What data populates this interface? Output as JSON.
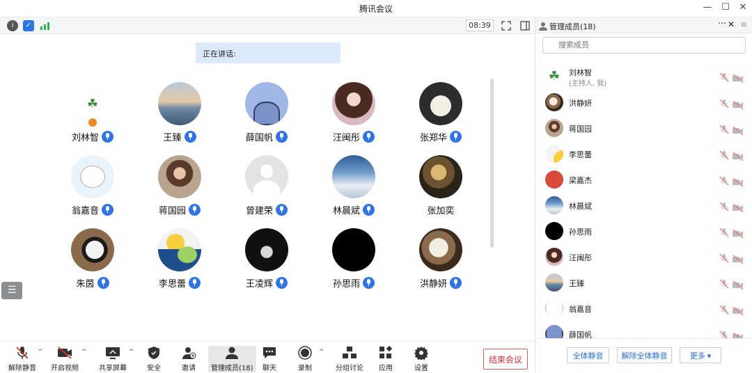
{
  "window": {
    "title": "腾讯会议"
  },
  "meeting": {
    "timer": "08:39",
    "speaking_label": "正在讲话:"
  },
  "participants": [
    {
      "name": "刘林智",
      "avatar": "clover-avatar",
      "mic": true
    },
    {
      "name": "王臻",
      "avatar": "beach-avatar",
      "mic": true
    },
    {
      "name": "薛国帆",
      "avatar": "cartoon-avatar",
      "mic": true
    },
    {
      "name": "汪闽彤",
      "avatar": "girl-avatar",
      "mic": true
    },
    {
      "name": "张郑华",
      "avatar": "dog-avatar",
      "mic": true
    },
    {
      "name": "翁嘉音",
      "avatar": "bear-avatar",
      "mic": true
    },
    {
      "name": "蒋国园",
      "avatar": "selfie-avatar",
      "mic": true
    },
    {
      "name": "曾建荣",
      "avatar": "default-avatar",
      "mic": true
    },
    {
      "name": "林晨斌",
      "avatar": "sky-avatar",
      "mic": true
    },
    {
      "name": "张加奕",
      "avatar": "painting-avatar",
      "mic": false
    },
    {
      "name": "朱茵",
      "avatar": "panda-avatar",
      "mic": true
    },
    {
      "name": "李思蕾",
      "avatar": "duck-avatar",
      "mic": true
    },
    {
      "name": "王凌辉",
      "avatar": "night-avatar",
      "mic": true
    },
    {
      "name": "孙思雨",
      "avatar": "black-avatar",
      "mic": true
    },
    {
      "name": "洪静妍",
      "avatar": "cat-avatar",
      "mic": true
    }
  ],
  "toolbar": {
    "unmute": "解除静音",
    "video": "开启视频",
    "share": "共享屏幕",
    "security": "安全",
    "invite": "邀请",
    "members": "管理成员(18)",
    "chat": "聊天",
    "record": "录制",
    "breakout": "分组讨论",
    "apps": "应用",
    "settings": "设置",
    "end": "结束会议"
  },
  "panel": {
    "title": "管理成员(18)",
    "search_placeholder": "搜索成员",
    "members": [
      {
        "name": "刘林智",
        "sub": "(主持人, 我)"
      },
      {
        "name": "洪静妍",
        "sub": ""
      },
      {
        "name": "蒋国园",
        "sub": ""
      },
      {
        "name": "李思蕾",
        "sub": ""
      },
      {
        "name": "梁嘉杰",
        "sub": ""
      },
      {
        "name": "林晨斌",
        "sub": ""
      },
      {
        "name": "孙思雨",
        "sub": ""
      },
      {
        "name": "汪闽彤",
        "sub": ""
      },
      {
        "name": "王臻",
        "sub": ""
      },
      {
        "name": "翁嘉音",
        "sub": ""
      },
      {
        "name": "薛国帆",
        "sub": ""
      }
    ],
    "mute_all": "全体静音",
    "unmute_all": "解除全体静音",
    "more": "更多 ▾"
  },
  "colors": {
    "accent": "#2f74e6",
    "end_red": "#e02e2e",
    "speaking_bg": "#dce9fb"
  }
}
